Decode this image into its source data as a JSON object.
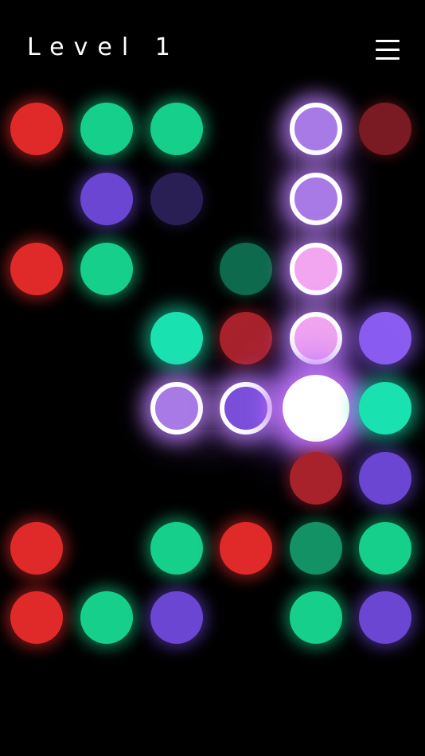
{
  "header": {
    "level_label": "Level 1",
    "menu_icon": "hamburger-menu-icon"
  },
  "colors": {
    "background": "#000000",
    "red": "#e02a2a",
    "green": "#16cf8b",
    "purple": "#6a46d2",
    "path_ring": "#ffffff",
    "active_glow": "#c878ff"
  },
  "board": {
    "columns": 6,
    "rows": 8,
    "grid": [
      [
        "red",
        "green",
        "green",
        null,
        "path-violet",
        "dim-red"
      ],
      [
        null,
        "purple",
        "dim-purple",
        null,
        "path-violet",
        null
      ],
      [
        "red",
        "green",
        null,
        "dim-green",
        "path-pink",
        null
      ],
      [
        null,
        null,
        "bright-green",
        "mid-red",
        "path-pink",
        "bright-purple"
      ],
      [
        null,
        null,
        "path-violet",
        "path-deep",
        "active",
        "bright-green"
      ],
      [
        null,
        null,
        null,
        null,
        "mid-red",
        "purple"
      ],
      [
        "red",
        null,
        "green",
        "red",
        "mid-green",
        "green"
      ],
      [
        "red",
        "green",
        "purple",
        null,
        "green",
        "purple"
      ]
    ]
  }
}
